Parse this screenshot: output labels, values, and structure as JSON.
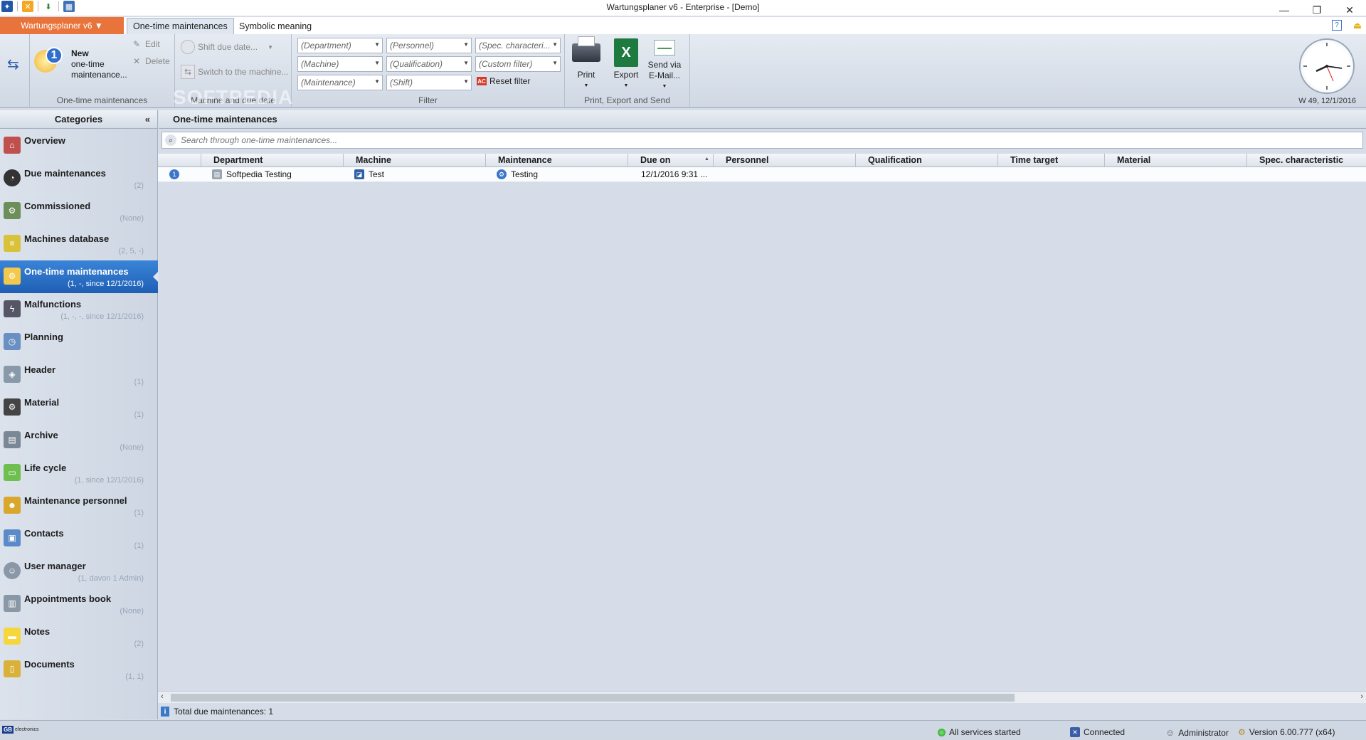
{
  "window": {
    "title": "Wartungsplaner v6 - Enterprise - [Demo]",
    "minimize": "—",
    "restore": "❐",
    "close": "✕"
  },
  "ribbon_tabs": {
    "app_menu": "Wartungsplaner v6 ▼",
    "tabs": [
      "One-time maintenances",
      "Symbolic meaning"
    ]
  },
  "ribbon": {
    "new_group": {
      "new_label_1": "New",
      "new_label_2": "one-time",
      "new_label_3": "maintenance...",
      "edit": "Edit",
      "delete": "Delete",
      "label": "One-time maintenances"
    },
    "machine_group": {
      "shift_due_date": "Shift due date...",
      "switch_machine": "Switch to the machine...",
      "label": "Machine and due date"
    },
    "filter_group": {
      "combos": [
        "(Department)",
        "(Personnel)",
        "(Spec. characteri...",
        "(Machine)",
        "(Qualification)",
        "(Custom filter)",
        "(Maintenance)",
        "(Shift)"
      ],
      "reset_filter": "Reset filter",
      "label": "Filter"
    },
    "print_group": {
      "print": "Print",
      "export": "Export",
      "send_1": "Send via",
      "send_2": "E-Mail...",
      "label": "Print, Export and Send"
    },
    "watermark": "SOFTPEDIA",
    "clock_date": "W 49, 12/1/2016"
  },
  "categories": {
    "title": "Categories",
    "collapse": "«",
    "items": [
      {
        "label": "Overview",
        "sub": ""
      },
      {
        "label": "Due maintenances",
        "sub": "(2)"
      },
      {
        "label": "Commissioned",
        "sub": "(None)"
      },
      {
        "label": "Machines database",
        "sub": "(2, 5, -)"
      },
      {
        "label": "One-time maintenances",
        "sub": "(1, -, since 12/1/2016)"
      },
      {
        "label": "Malfunctions",
        "sub": "(1, -, -, since 12/1/2016)"
      },
      {
        "label": "Planning",
        "sub": ""
      },
      {
        "label": "Header",
        "sub": "(1)"
      },
      {
        "label": "Material",
        "sub": "(1)"
      },
      {
        "label": "Archive",
        "sub": "(None)"
      },
      {
        "label": "Life cycle",
        "sub": "(1, since 12/1/2016)"
      },
      {
        "label": "Maintenance personnel",
        "sub": "(1)"
      },
      {
        "label": "Contacts",
        "sub": "(1)"
      },
      {
        "label": "User manager",
        "sub": "(1, davon 1 Admin)"
      },
      {
        "label": "Appointments book",
        "sub": "(None)"
      },
      {
        "label": "Notes",
        "sub": "(2)"
      },
      {
        "label": "Documents",
        "sub": "(1, 1)"
      }
    ]
  },
  "main": {
    "title": "One-time maintenances",
    "search_placeholder": "Search through one-time maintenances...",
    "columns": [
      "Department",
      "Machine",
      "Maintenance",
      "Due on",
      "Personnel",
      "Qualification",
      "Time target",
      "Material",
      "Spec. characteristic"
    ],
    "rows": [
      {
        "department": "Softpedia Testing",
        "machine": "Test",
        "maintenance": "Testing",
        "due_on": "12/1/2016 9:31 ..."
      }
    ],
    "total": "Total due maintenances: 1"
  },
  "statusbar": {
    "services": "All services started",
    "connection": "Connected",
    "user": "Administrator",
    "version": "Version 6.00.777 (x64)",
    "logo_gb": "GB",
    "logo_text": "electronics"
  }
}
